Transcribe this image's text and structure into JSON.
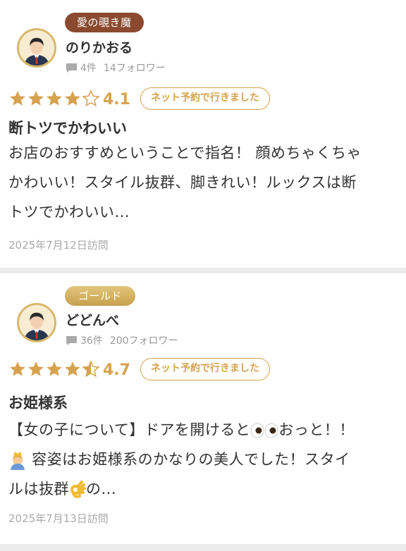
{
  "reviews": [
    {
      "rank_badge": "愛の覗き魔",
      "username": "のりかおる",
      "review_count": "4件",
      "followers": "14フォロワー",
      "score": "4.1",
      "stars": 4.1,
      "booking_badge": "ネット予約で行きました",
      "title": "断トツでかわいい",
      "body_lines": [
        "お店のおすすめということで指名！ 顔めちゃくちゃ",
        "かわいい！スタイル抜群、脚きれい！ルックスは断",
        "トツでかわいい..."
      ],
      "visit_date": "2025年7月12日訪問"
    },
    {
      "rank_badge": "ゴールド",
      "username": "どどんべ",
      "review_count": "36件",
      "followers": "200フォロワー",
      "score": "4.7",
      "stars": 4.7,
      "booking_badge": "ネット予約で行きました",
      "title": "お姫様系",
      "body_line1_a": "【女の子について】ドアを開けると",
      "body_line1_b": "おっと！！",
      "body_line2": " 容姿はお姫様系のかなりの美人でした！スタイ",
      "body_line3_a": "ルは抜群",
      "body_line3_b": "の...",
      "visit_date": "2025年7月13日訪問"
    }
  ],
  "colors": {
    "accent": "#d7a24f",
    "brown_badge": "#8b4a2f",
    "gold_badge": "#d4b162"
  },
  "icons": [
    "avatar-icon",
    "comment-icon",
    "star-icon",
    "eyes-emoji",
    "princess-emoji",
    "ok-hand-emoji"
  ]
}
